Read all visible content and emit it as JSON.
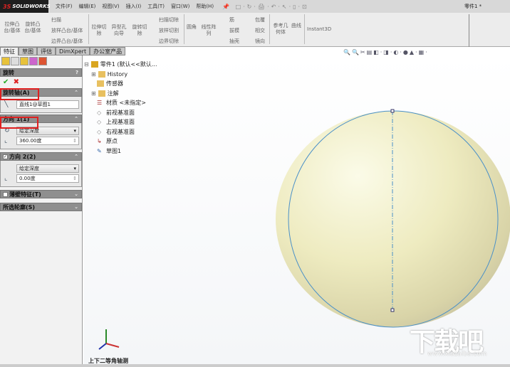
{
  "app": {
    "logo": "SOLIDWORKS",
    "doc_title": "零件1 *"
  },
  "menu": [
    "文件(F)",
    "编辑(E)",
    "视图(V)",
    "插入(I)",
    "工具(T)",
    "窗口(W)",
    "帮助(H)"
  ],
  "toolbar": {
    "extrude_boss": "拉伸凸台/基体",
    "revolve_boss": "旋转凸台/基体",
    "sweep": "扫描",
    "loft": "放样凸台/基体",
    "boundary": "边界凸台/基体",
    "extrude_cut": "拉伸切除",
    "hole_wizard": "异型孔向导",
    "revolve_cut": "旋转切除",
    "sweep_cut": "扫描切除",
    "loft_cut": "放样切割",
    "boundary_cut": "边界切除",
    "fillet": "圆角",
    "linear_pattern": "线性阵列",
    "rib": "筋",
    "draft": "拔模",
    "shell": "抽壳",
    "wrap": "包覆",
    "intersect": "相交",
    "mirror": "镜向",
    "ref_geometry": "参考几何体",
    "curves": "曲线",
    "instant3d": "Instant3D"
  },
  "tabs": [
    "特征",
    "草图",
    "评估",
    "DimXpert",
    "办公室产品"
  ],
  "property_manager": {
    "title": "旋转",
    "help": "?",
    "axis_section": {
      "title": "旋转轴(A)",
      "value": "直线1@草图1"
    },
    "dir1_section": {
      "title": "方向 1(1)",
      "type": "给定深度",
      "angle": "360.00度"
    },
    "dir2_section": {
      "title": "方向 2(2)",
      "type": "给定深度",
      "angle": "0.00度"
    },
    "thin_section": {
      "title": "薄壁特征(T)"
    },
    "contours_section": {
      "title": "所选轮廓(S)"
    }
  },
  "tree": {
    "root": "零件1 (默认<<默认...",
    "items": [
      "History",
      "传感器",
      "注解",
      "材质 <未指定>",
      "前视基准面",
      "上视基准面",
      "右视基准面",
      "原点",
      "草图1"
    ]
  },
  "view": {
    "name": "上下二等角轴测"
  },
  "watermark": {
    "text": "下载吧",
    "url": "www.xiazaiba.com"
  }
}
